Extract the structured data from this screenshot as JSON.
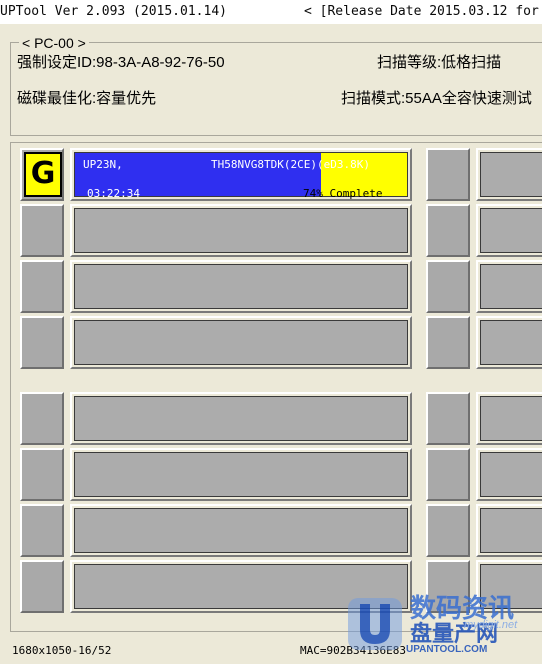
{
  "window": {
    "title_left": "UPTool Ver 2.093 (2015.01.14)",
    "title_right": "< [Release Date 2015.03.12 for"
  },
  "info": {
    "group_label": "< PC-00 >",
    "forced_id": "强制设定ID:98-3A-A8-92-76-50",
    "scan_level": "扫描等级:低格扫描",
    "disk_optimize": "磁碟最佳化:容量优先",
    "scan_mode": "扫描模式:55AA全容快速测试"
  },
  "ports": {
    "active": {
      "grade": "G",
      "model": "UP23N,",
      "flash": "TH58NVG8TDK(2CE)(eD3.8K)",
      "time": "03:22:34",
      "progress_text": "74% Complete",
      "progress": 0.26
    }
  },
  "status": {
    "resolution": "1680x1050-16/52",
    "mac": "MAC=902B34136E83"
  },
  "watermark": {
    "cn_top": "数码资讯",
    "cn_bottom": "盘量产网",
    "url_small": "mydigit.net",
    "url": "UPANTOOL.COM"
  },
  "colors": {
    "active_bar": "#2f2ff0",
    "progress_fill": "#ffff00",
    "idle_port": "#acacac"
  }
}
